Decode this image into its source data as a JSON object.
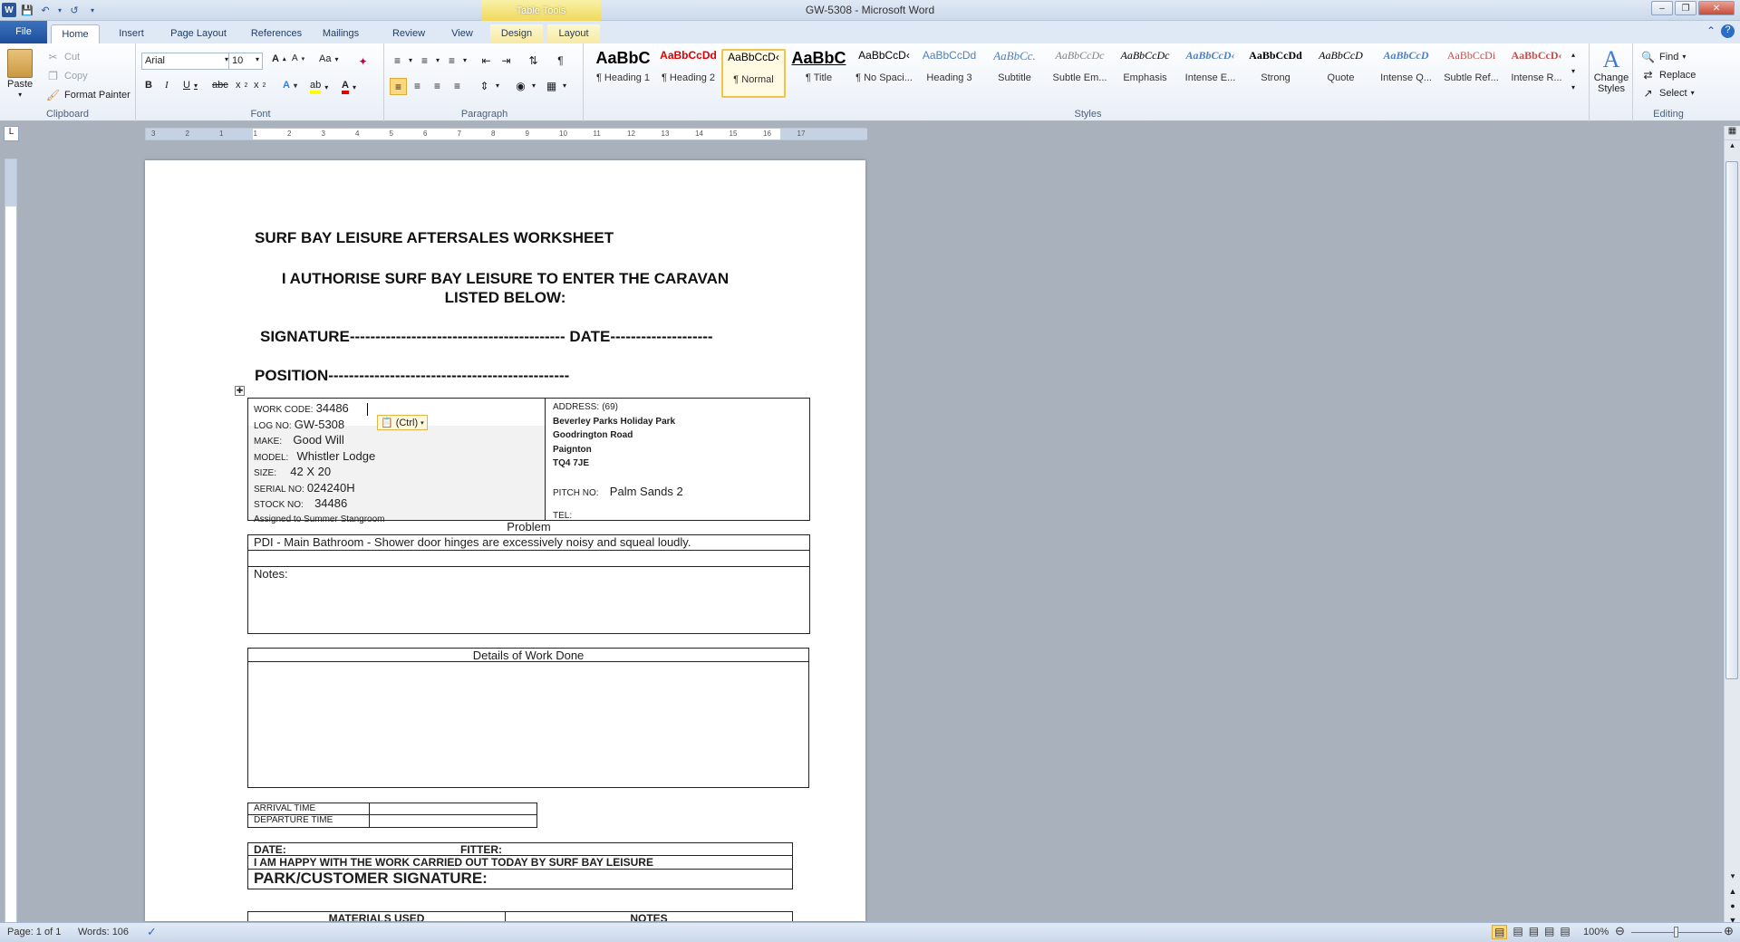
{
  "window": {
    "title": "GW-5308  -  Microsoft Word",
    "context_tab_group": "Table Tools"
  },
  "tabs": [
    "File",
    "Home",
    "Insert",
    "Page Layout",
    "References",
    "Mailings",
    "Review",
    "View",
    "Design",
    "Layout"
  ],
  "clipboard": {
    "paste": "Paste",
    "cut": "Cut",
    "copy": "Copy",
    "format_painter": "Format Painter",
    "label": "Clipboard"
  },
  "font": {
    "name": "Arial",
    "size": "10",
    "label": "Font"
  },
  "paragraph": {
    "label": "Paragraph"
  },
  "styles": {
    "label": "Styles",
    "items": [
      {
        "sample": "AaBbC",
        "name": "¶ Heading 1",
        "color": "#000000"
      },
      {
        "sample": "AaBbCcDd",
        "name": "¶ Heading 2",
        "color": "#e00000"
      },
      {
        "sample": "AaBbCcD‹",
        "name": "¶ Normal",
        "color": "#000000"
      },
      {
        "sample": "AaBbC",
        "name": "¶ Title",
        "color": "#000000"
      },
      {
        "sample": "AaBbCcD‹",
        "name": "¶ No Spaci...",
        "color": "#000000"
      },
      {
        "sample": "AaBbCcDd",
        "name": "Heading 3",
        "color": "#4f81bd"
      },
      {
        "sample": "AaBbCc.",
        "name": "Subtitle",
        "color": "#4f81bd"
      },
      {
        "sample": "AaBbCcDc",
        "name": "Subtle Em...",
        "color": "#808080"
      },
      {
        "sample": "AaBbCcDc",
        "name": "Emphasis",
        "color": "#000000"
      },
      {
        "sample": "AaBbCcD‹",
        "name": "Intense E...",
        "color": "#4f81bd"
      },
      {
        "sample": "AaBbCcDd",
        "name": "Strong",
        "color": "#000000"
      },
      {
        "sample": "AaBbCcD",
        "name": "Quote",
        "color": "#000000"
      },
      {
        "sample": "AaBbCcD",
        "name": "Intense Q...",
        "color": "#4f81bd"
      },
      {
        "sample": "AaBbCcDi",
        "name": "Subtle Ref...",
        "color": "#c0504d"
      },
      {
        "sample": "AaBbCcD‹",
        "name": "Intense R...",
        "color": "#c0504d"
      }
    ],
    "change_styles": "Change Styles"
  },
  "editing": {
    "find": "Find",
    "replace": "Replace",
    "select": "Select",
    "label": "Editing"
  },
  "ruler": {
    "h_ticks": [
      "3",
      "2",
      "1",
      "1",
      "2",
      "3",
      "4",
      "5",
      "6",
      "7",
      "8",
      "9",
      "10",
      "11",
      "12",
      "13",
      "14",
      "15",
      "16",
      "17"
    ]
  },
  "doc": {
    "heading": "SURF BAY LEISURE AFTERSALES WORKSHEET",
    "authorise_line1": "I AUTHORISE SURF BAY LEISURE TO ENTER THE CARAVAN",
    "authorise_line2": "LISTED BELOW:",
    "signature": "SIGNATURE------------------------------------------ DATE--------------------",
    "position": "POSITION-----------------------------------------------",
    "work_code_label": "WORK CODE:",
    "work_code": "34486",
    "log_label": "LOG NO:",
    "log_no": "GW-5308",
    "make_label": "MAKE:",
    "make": "Good Will",
    "model_label": "MODEL:",
    "model": "Whistler Lodge",
    "size_label": "SIZE:",
    "size": "42 X 20",
    "serial_label": "SERIAL  NO:",
    "serial": "024240H",
    "stock_label": "STOCK NO:",
    "stock": "34486",
    "assigned": "Assigned to Summer Stangroom",
    "paste_options": "(Ctrl)",
    "address_label": "ADDRESS:",
    "address_no": "(69)",
    "address_lines": [
      "Beverley  Parks  Holiday  Park",
      "Goodrington Road",
      "Paignton",
      "TQ4 7JE"
    ],
    "pitch_label": "PITCH NO:",
    "pitch": "Palm Sands 2",
    "tel_label": "TEL:",
    "problem_header": "Problem",
    "problem_text": "PDI - Main Bathroom - Shower door hinges are excessively noisy and squeal loudly.",
    "notes_label": "Notes:",
    "details_header": "Details of Work Done",
    "arrival": "ARRIVAL  TIME",
    "departure": "DEPARTURE  TIME",
    "date_label": "DATE:",
    "fitter_label": "FITTER:",
    "happy": "I AM HAPPY WITH THE WORK CARRIED OUT TODAY BY SURF BAY LEISURE",
    "park_sig": "PARK/CUSTOMER SIGNATURE:",
    "materials": "MATERIALS USED",
    "notes_col": "NOTES"
  },
  "status": {
    "page": "Page: 1 of 1",
    "words": "Words: 106",
    "zoom": "100%"
  }
}
